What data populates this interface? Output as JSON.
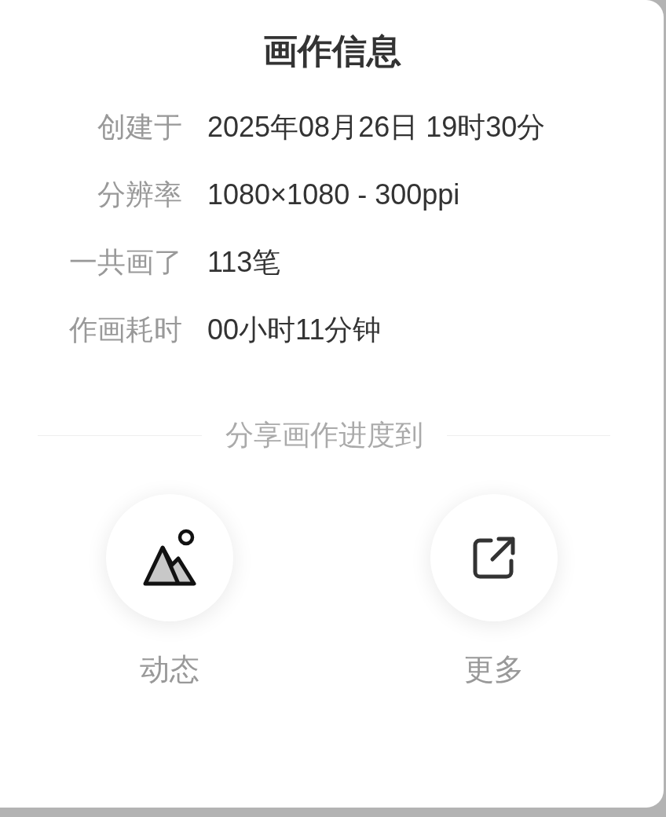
{
  "title": "画作信息",
  "info": [
    {
      "label": "创建于",
      "value": "2025年08月26日 19时30分"
    },
    {
      "label": "分辨率",
      "value": "1080×1080 - 300ppi"
    },
    {
      "label": "一共画了",
      "value": "113笔"
    },
    {
      "label": "作画耗时",
      "value": "00小时11分钟"
    }
  ],
  "share_heading": "分享画作进度到",
  "share_targets": [
    {
      "kind": "moments",
      "label": "动态"
    },
    {
      "kind": "more",
      "label": "更多"
    }
  ]
}
